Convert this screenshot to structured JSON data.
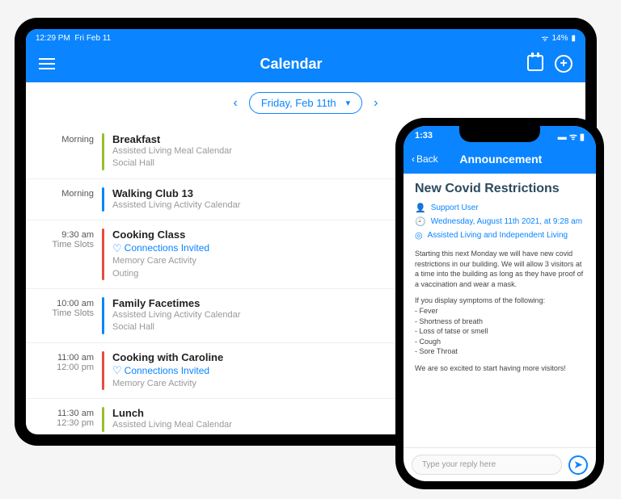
{
  "tablet": {
    "status": {
      "time": "12:29 PM",
      "date": "Fri Feb 11",
      "battery": "14%"
    },
    "header": {
      "title": "Calendar"
    },
    "date_nav": {
      "label": "Friday, Feb 11th"
    },
    "events": [
      {
        "time1": "Morning",
        "time2": "",
        "bar": "#9cbd2e",
        "title": "Breakfast",
        "invite": "",
        "sub1": "Assisted Living  Meal Calendar",
        "sub2": "Social Hall"
      },
      {
        "time1": "Morning",
        "time2": "",
        "bar": "#0a84ff",
        "title": "Walking Club 13",
        "invite": "",
        "sub1": "Assisted Living Activity Calendar",
        "sub2": ""
      },
      {
        "time1": "9:30 am",
        "time2": "Time Slots",
        "bar": "#e74c3c",
        "title": "Cooking Class",
        "invite": "Connections Invited",
        "sub1": "Memory Care Activity",
        "sub2": "Outing"
      },
      {
        "time1": "10:00 am",
        "time2": "Time Slots",
        "bar": "#0a84ff",
        "title": "Family Facetimes",
        "invite": "",
        "sub1": "Assisted Living Activity Calendar",
        "sub2": "Social Hall"
      },
      {
        "time1": "11:00 am",
        "time2": "12:00 pm",
        "bar": "#e74c3c",
        "title": "Cooking with Caroline",
        "invite": "Connections Invited",
        "sub1": "Memory Care Activity",
        "sub2": ""
      },
      {
        "time1": "11:30 am",
        "time2": "12:30 pm",
        "bar": "#9cbd2e",
        "title": "Lunch",
        "invite": "",
        "sub1": "Assisted Living  Meal Calendar",
        "sub2": ""
      }
    ]
  },
  "phone": {
    "status": {
      "time": "1:33"
    },
    "header": {
      "back": "Back",
      "title": "Announcement"
    },
    "announcement": {
      "title": "New Covid Restrictions",
      "author": "Support User",
      "date": "Wednesday, August 11th 2021, at 9:28 am",
      "location": "Assisted Living and Independent Living",
      "p1": "Starting this next Monday we will have new covid restrictions in our building. We will allow 3 visitors at a time into the building as long as they have proof of a vaccination and wear a mask.",
      "p2": "If you display symptoms of the following:",
      "sym1": "- Fever",
      "sym2": "- Shortness of breath",
      "sym3": "- Loss of tatse or smell",
      "sym4": "- Cough",
      "sym5": "- Sore Throat",
      "p3": "We are so excited to start having more visitors!"
    },
    "reply": {
      "placeholder": "Type your reply here"
    }
  }
}
